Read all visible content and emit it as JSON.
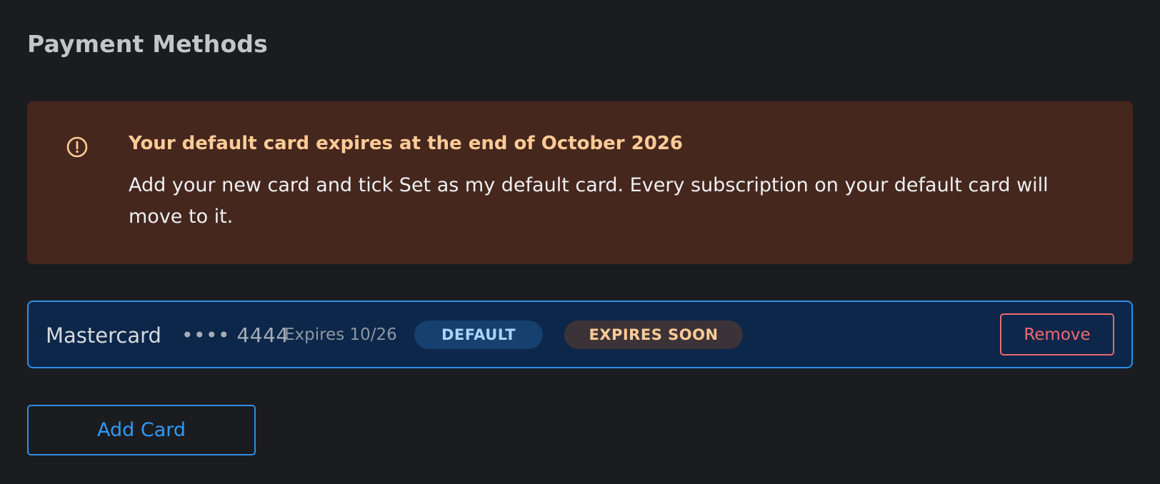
{
  "page": {
    "title": "Payment Methods"
  },
  "alert": {
    "icon": "exclamation-circle-icon",
    "title": "Your default card expires at the end of October 2026",
    "body": "Add your new card and tick Set as my default card. Every subscription on your default card will move to it.",
    "accent_color": "#ffcb96",
    "background_color": "#45271e"
  },
  "cards": [
    {
      "brand": "Mastercard",
      "number_masked": "•••• 4444",
      "expiry_label": "Expires 10/26",
      "badges": {
        "default": "DEFAULT",
        "expiring": "EXPIRES SOON"
      },
      "remove_label": "Remove",
      "selected": true
    }
  ],
  "actions": {
    "add_card_label": "Add Card"
  },
  "colors": {
    "accent": "#2f8fe8",
    "danger": "#e96b70",
    "background": "#1b1c1f"
  }
}
